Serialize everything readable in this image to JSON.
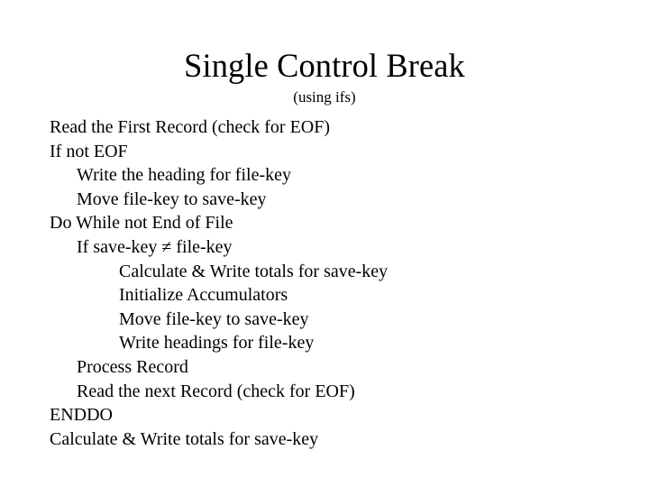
{
  "slide": {
    "title": "Single Control Break",
    "subtitle": "(using ifs)",
    "background_color": "#ffffff",
    "text_color": "#000000",
    "lines": [
      {
        "text": "Read the First Record (check for EOF)",
        "indent": 0
      },
      {
        "text": "If not EOF",
        "indent": 0
      },
      {
        "text": "Write the heading for file-key",
        "indent": 1
      },
      {
        "text": "Move file-key to save-key",
        "indent": 1
      },
      {
        "text": "Do While not End of File",
        "indent": 0
      },
      {
        "text": "If save-key ≠ file-key",
        "indent": 1
      },
      {
        "text": "Calculate & Write totals for save-key",
        "indent": 2
      },
      {
        "text": "Initialize Accumulators",
        "indent": 2
      },
      {
        "text": "Move file-key to save-key",
        "indent": 2
      },
      {
        "text": "Write headings for file-key",
        "indent": 2
      },
      {
        "text": "Process Record",
        "indent": 1
      },
      {
        "text": "Read the next Record (check for EOF)",
        "indent": 1
      },
      {
        "text": "ENDDO",
        "indent": 0
      },
      {
        "text": "Calculate & Write totals for save-key",
        "indent": 0
      }
    ]
  }
}
